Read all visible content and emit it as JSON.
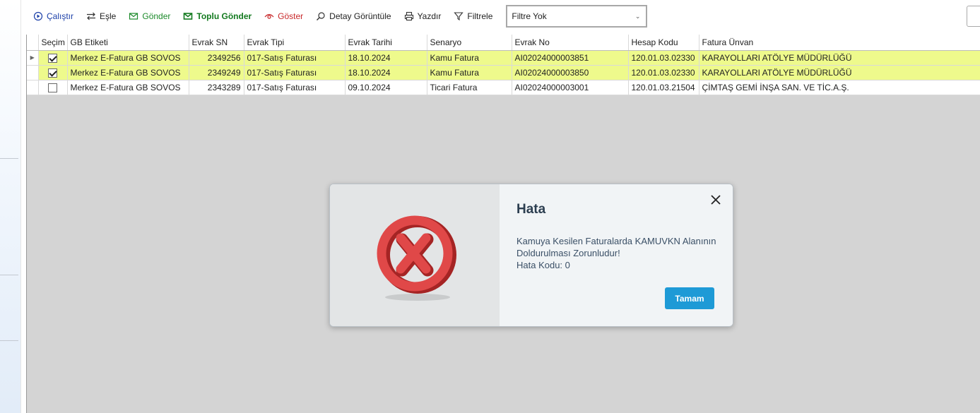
{
  "toolbar": {
    "run_label": "Çalıştır",
    "map_label": "Eşle",
    "send_label": "Gönder",
    "bulk_send_label": "Toplu Gönder",
    "show_label": "Göster",
    "detail_label": "Detay Görüntüle",
    "print_label": "Yazdır",
    "filter_label": "Filtrele",
    "filter_select_value": "Filtre Yok"
  },
  "grid": {
    "columns": [
      "Seçim",
      "GB Etiketi",
      "Evrak SN",
      "Evrak Tipi",
      "Evrak Tarihi",
      "Senaryo",
      "Evrak No",
      "Hesap Kodu",
      "Fatura Ünvan"
    ],
    "rows": [
      {
        "selected": true,
        "gb": "Merkez E-Fatura GB SOVOS",
        "sn": "2349256",
        "tip": "017-Satış Faturası",
        "tarih": "18.10.2024",
        "senaryo": "Kamu Fatura",
        "no": "AI02024000003851",
        "hesap": "120.01.03.02330",
        "unvan": "KARAYOLLARI ATÖLYE MÜDÜRLÜĞÜ"
      },
      {
        "selected": true,
        "gb": "Merkez E-Fatura GB SOVOS",
        "sn": "2349249",
        "tip": "017-Satış Faturası",
        "tarih": "18.10.2024",
        "senaryo": "Kamu Fatura",
        "no": "AI02024000003850",
        "hesap": "120.01.03.02330",
        "unvan": "KARAYOLLARI ATÖLYE MÜDÜRLÜĞÜ"
      },
      {
        "selected": false,
        "gb": "Merkez E-Fatura GB SOVOS",
        "sn": "2343289",
        "tip": "017-Satış Faturası",
        "tarih": "09.10.2024",
        "senaryo": "Ticari Fatura",
        "no": "AI02024000003001",
        "hesap": "120.01.03.21504",
        "unvan": "ÇİMTAŞ GEMİ İNŞA SAN. VE TİC.A.Ş."
      }
    ]
  },
  "dialog": {
    "title": "Hata",
    "message_line1": "Kamuya Kesilen Faturalarda KAMUVKN Alanının Doldurulması Zorunludur!",
    "message_line2": "Hata Kodu: 0",
    "ok_label": "Tamam",
    "icon": "error-x-icon",
    "icon_color": "#d93a3a"
  },
  "colors": {
    "highlight_row": "#eefa8c",
    "ok_button": "#1e9ad6",
    "workspace": "#d4d4d4"
  }
}
